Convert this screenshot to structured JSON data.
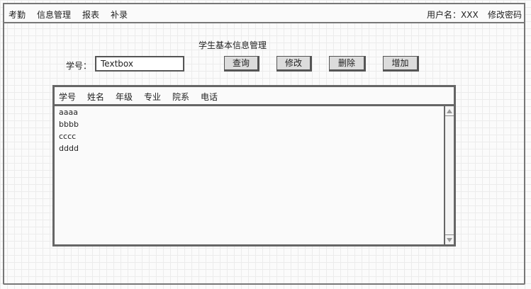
{
  "menu": {
    "items": [
      {
        "label": "考勤"
      },
      {
        "label": "信息管理"
      },
      {
        "label": "报表"
      },
      {
        "label": "补录"
      }
    ]
  },
  "user": {
    "label": "用户名：XXX",
    "change_password": "修改密码"
  },
  "page": {
    "title": "学生基本信息管理"
  },
  "search": {
    "label": "学号：",
    "value": "Textbox"
  },
  "buttons": {
    "query": "查询",
    "edit": "修改",
    "delete": "删除",
    "add": "增加"
  },
  "table": {
    "columns": [
      "学号",
      "姓名",
      "年级",
      "专业",
      "院系",
      "电话"
    ],
    "rows": [
      "aaaa",
      "bbbb",
      "cccc",
      "dddd"
    ]
  }
}
